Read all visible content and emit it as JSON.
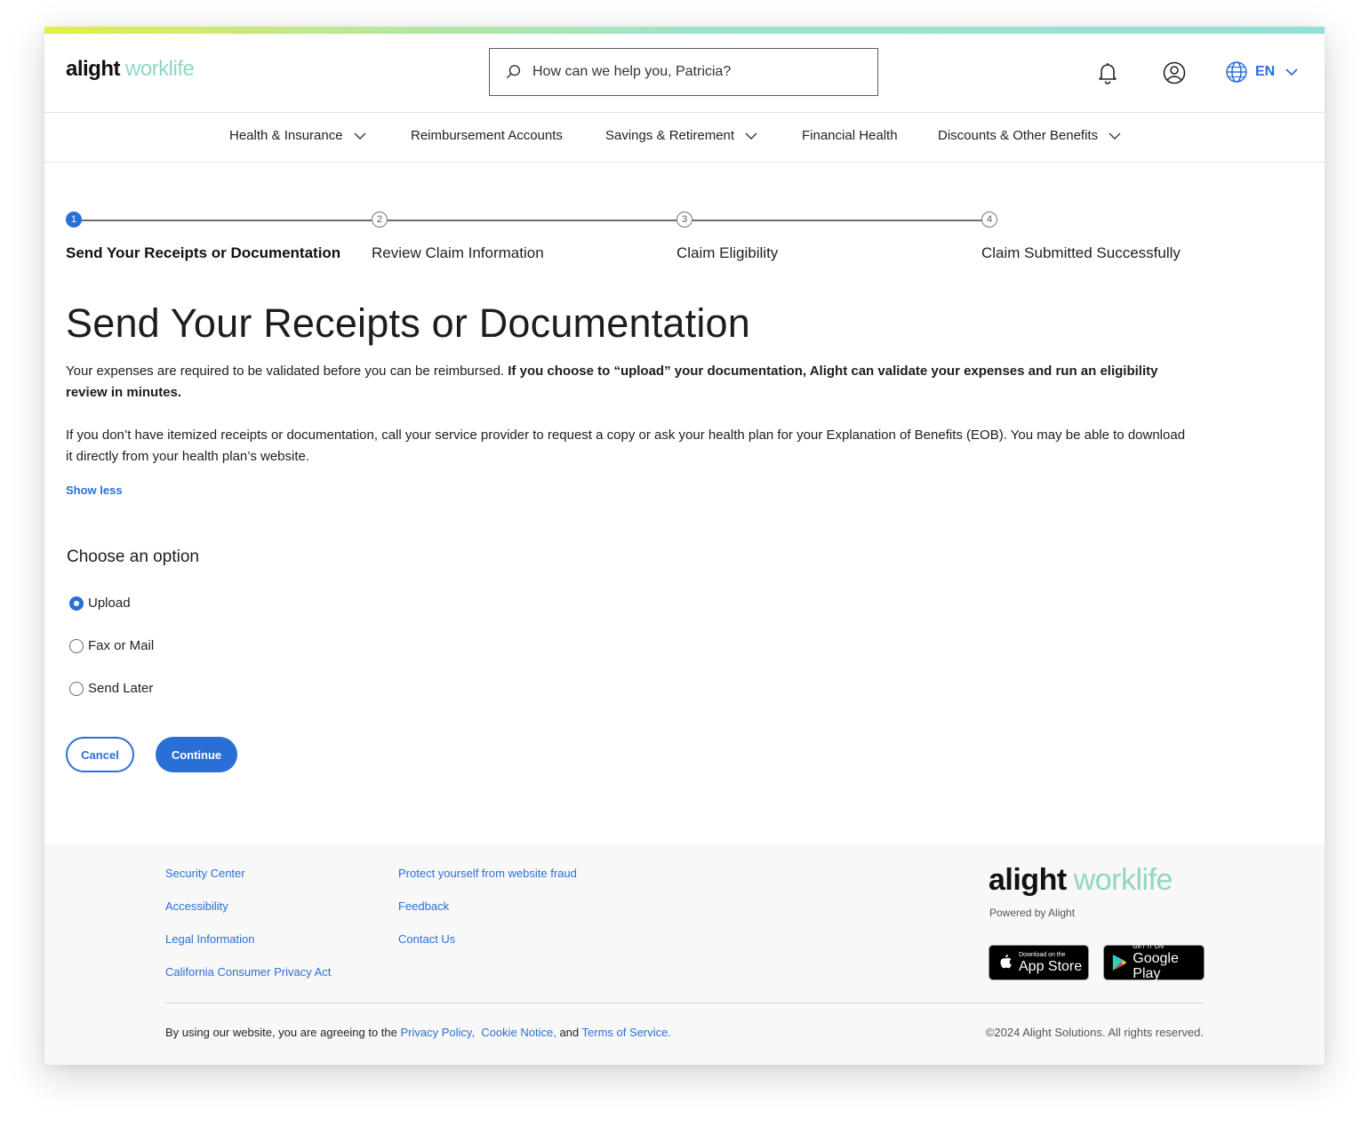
{
  "brand": {
    "logo_main": "alight",
    "logo_accent": "worklife",
    "accent_color": "#2a6fd6"
  },
  "header": {
    "search_placeholder": "How can we help you, Patricia?",
    "language": "EN"
  },
  "nav": {
    "items": [
      {
        "label": "Health & Insurance",
        "has_dropdown": true
      },
      {
        "label": "Reimbursement Accounts",
        "has_dropdown": false
      },
      {
        "label": "Savings & Retirement",
        "has_dropdown": true
      },
      {
        "label": "Financial Health",
        "has_dropdown": false
      },
      {
        "label": "Discounts & Other Benefits",
        "has_dropdown": true
      }
    ]
  },
  "stepper": {
    "current_step": 1,
    "steps": [
      {
        "number": "1",
        "label": "Send Your Receipts or Documentation"
      },
      {
        "number": "2",
        "label": "Review Claim Information"
      },
      {
        "number": "3",
        "label": "Claim Eligibility"
      },
      {
        "number": "4",
        "label": "Claim Submitted Successfully"
      }
    ]
  },
  "main": {
    "title": "Send Your Receipts or Documentation",
    "para1_normal": "Your expenses are required to be validated before you can be reimbursed. ",
    "para1_bold": "If you choose to “upload” your documentation, Alight can validate your expenses and run an eligibility review in minutes.",
    "para2": "If you don’t have itemized receipts or documentation, call your service provider to request a copy or ask your health plan for your Explanation of Benefits (EOB). You may be able to download it directly from your health plan’s website.",
    "show_less": "Show less",
    "choose_label": "Choose an option",
    "options": [
      {
        "label": "Upload",
        "selected": true
      },
      {
        "label": "Fax or Mail",
        "selected": false
      },
      {
        "label": "Send Later",
        "selected": false
      }
    ],
    "cancel_label": "Cancel",
    "continue_label": "Continue"
  },
  "footer": {
    "col1": [
      "Security Center",
      "Accessibility",
      "Legal Information",
      "California Consumer Privacy Act"
    ],
    "col2": [
      "Protect yourself from website fraud",
      "Feedback",
      "Contact Us"
    ],
    "logo_main": "alight",
    "logo_accent": "worklife",
    "powered_by": "Powered by Alight",
    "app_store_small": "Download on the",
    "app_store_big": "App Store",
    "google_play_small": "GET IT ON",
    "google_play_big": "Google Play",
    "legal_prefix": "By using our website, you are agreeing to the ",
    "privacy_policy": "Privacy Policy,",
    "cookie_notice": "Cookie Notice,",
    "legal_and": " and ",
    "terms": "Terms of Service.",
    "copyright": "©2024 Alight Solutions. All rights reserved."
  }
}
